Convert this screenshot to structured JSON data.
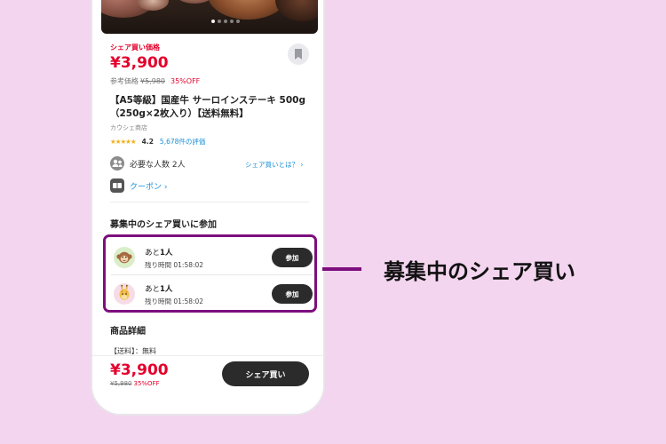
{
  "product": {
    "share_price_label": "シェア買い価格",
    "price": "¥3,900",
    "reference_label": "参考価格",
    "reference_price": "¥5,980",
    "discount": "35%OFF",
    "title": "【A5等級】国産牛 サーロインステーキ 500g（250g×2枚入り）【送料無料】",
    "shop": "カウシェ商店",
    "stars": "★★★★★",
    "rating": "4.2",
    "reviews": "5,678件の評価"
  },
  "info": {
    "required_people": "必要な人数 2人",
    "what_is_share_link": "シェア買いとは？ ›",
    "coupon": "クーポン ›"
  },
  "recruiting": {
    "heading": "募集中のシェア買いに参加",
    "groups": [
      {
        "remaining_prefix": "あと",
        "remaining_count": "1人",
        "time_left": "残り時間 01:58:02",
        "join_label": "参加"
      },
      {
        "remaining_prefix": "あと",
        "remaining_count": "1人",
        "time_left": "残り時間 01:58:02",
        "join_label": "参加"
      }
    ]
  },
  "details": {
    "heading": "商品詳細",
    "shipping": "【送料】：無料"
  },
  "bottom_bar": {
    "price": "¥3,900",
    "reference_price": "¥5,980",
    "discount": "35%OFF",
    "share_button": "シェア買い"
  },
  "callout": {
    "text": "募集中のシェア買い"
  },
  "colors": {
    "background": "#f3d5ef",
    "price_red": "#e4002b",
    "highlight_purple": "#7c0f7d",
    "link_blue": "#1a8fd8",
    "button_dark": "#2b2b2b"
  },
  "icons": [
    "bookmark-icon",
    "people-icon",
    "coupon-icon",
    "monkey-avatar-icon",
    "giraffe-avatar-icon"
  ]
}
